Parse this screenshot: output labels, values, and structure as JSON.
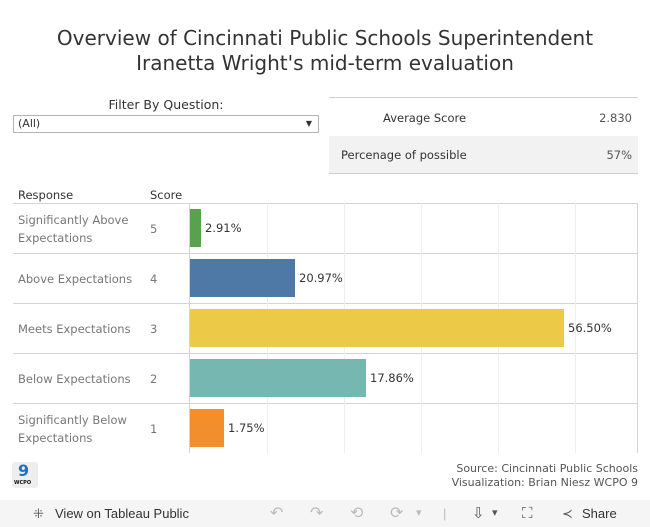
{
  "title": {
    "line1": "Overview of Cincinnati Public Schools Superintendent",
    "line2": "Iranetta Wright's mid-term evaluation"
  },
  "filter": {
    "label": "Filter By Question:",
    "selected": "(All)",
    "arrow_icon": "▼"
  },
  "kpis": [
    {
      "label": "Average Score",
      "value": "2.830"
    },
    {
      "label": "Percenage of possible",
      "value": "57%"
    }
  ],
  "table": {
    "headers": {
      "response": "Response",
      "score": "Score"
    }
  },
  "chart_data": {
    "type": "bar",
    "orientation": "horizontal",
    "categories": [
      "Significantly Above Expectations",
      "Above Expectations",
      "Meets Expectations",
      "Below Expectations",
      "Significantly Below Expectations"
    ],
    "scores": [
      "5",
      "4",
      "3",
      "2",
      "1"
    ],
    "labels": [
      "2.91%",
      "20.97%",
      "56.50%",
      "17.86%",
      "1.75%"
    ],
    "values": [
      2.91,
      20.97,
      56.5,
      17.86,
      1.75
    ],
    "relative_bar_length": [
      0.03,
      0.28,
      1.0,
      0.47,
      0.09
    ],
    "colors": [
      "#59a14f",
      "#4e79a7",
      "#edc948",
      "#76b7b2",
      "#f28e2b"
    ],
    "gridlines": 5,
    "grid": true,
    "title": "",
    "xlabel": "",
    "ylabel": ""
  },
  "footer": {
    "logo": {
      "numeral": "9",
      "text": "WCPO"
    },
    "source_line1": "Source: Cincinnati Public Schools",
    "source_line2": "Visualization: Brian Niesz WCPO 9"
  },
  "toolbar": {
    "view_label": "View on Tableau Public",
    "share_label": "Share",
    "icons": {
      "tableau": "⁜",
      "undo": "↶",
      "redo": "↷",
      "revert": "⟲",
      "refresh": "⟳",
      "dropdown": "▾",
      "download": "⇩",
      "fullscreen": "⛶",
      "share": "≺"
    }
  }
}
